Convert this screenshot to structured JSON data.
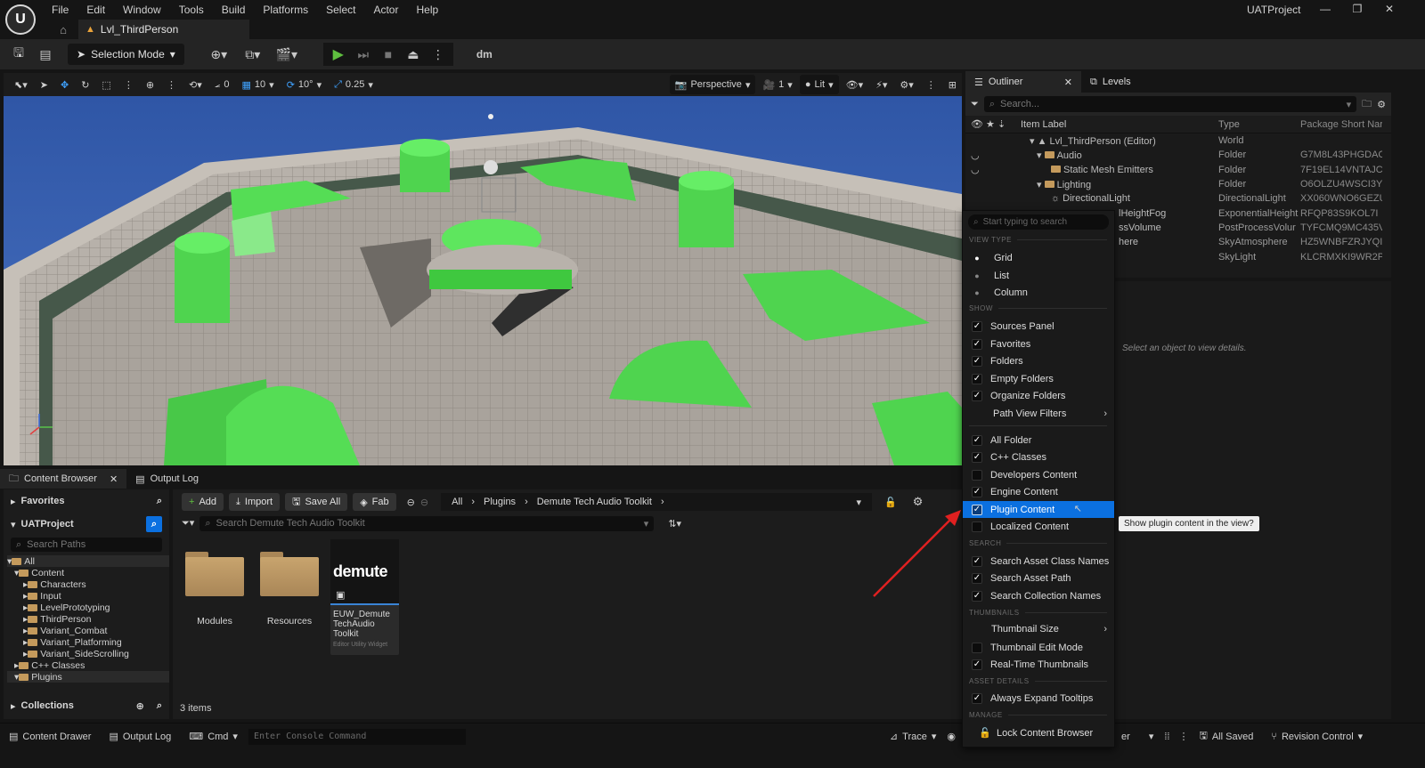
{
  "menu": [
    "File",
    "Edit",
    "Window",
    "Tools",
    "Build",
    "Platforms",
    "Select",
    "Actor",
    "Help"
  ],
  "level_tab": "Lvl_ThirdPerson",
  "project": "UATProject",
  "toolbar": {
    "selection_mode": "Selection Mode",
    "platform": "dm"
  },
  "viewport_toolbar": {
    "grid_snap": "10",
    "rotation_snap": "10°",
    "scale_snap": "0.25",
    "rot_value": "0",
    "perspective": "Perspective",
    "camera_speed": "1",
    "view_mode": "Lit"
  },
  "outliner": {
    "tab_label": "Outliner",
    "levels_tab": "Levels",
    "search_placeholder": "Search...",
    "columns": [
      "Item Label",
      "Type",
      "Package Short Nar"
    ],
    "rows": [
      {
        "label": "Lvl_ThirdPerson (Editor)",
        "type": "World",
        "pkg": ""
      },
      {
        "label": "Audio",
        "type": "Folder",
        "pkg": "G7M8L43PHGDAC"
      },
      {
        "label": "Static Mesh Emitters",
        "type": "Folder",
        "pkg": "7F19EL14VNTAJC"
      },
      {
        "label": "Lighting",
        "type": "Folder",
        "pkg": "O6OLZU4WSCI3Y"
      },
      {
        "label": "DirectionalLight",
        "type": "DirectionalLight",
        "pkg": "XX060WNO6GEZU"
      },
      {
        "label": "lHeightFog",
        "type": "ExponentialHeight",
        "pkg": "RFQP83S9KOL7I"
      },
      {
        "label": "ssVolume",
        "type": "PostProcessVolur",
        "pkg": "TYFCMQ9MC435V"
      },
      {
        "label": "here",
        "type": "SkyAtmosphere",
        "pkg": "HZ5WNBFZRJYQI"
      },
      {
        "label": "",
        "type": "SkyLight",
        "pkg": "KLCRMXKI9WR2P"
      }
    ]
  },
  "details": {
    "empty_message": "Select an object to view details."
  },
  "content_browser": {
    "tab_label": "Content Browser",
    "output_log_tab": "Output Log",
    "favorites": "Favorites",
    "project": "UATProject",
    "search_paths_placeholder": "Search Paths",
    "tree": [
      "All",
      "Content",
      "Characters",
      "Input",
      "LevelPrototyping",
      "ThirdPerson",
      "Variant_Combat",
      "Variant_Platforming",
      "Variant_SideScrolling",
      "C++ Classes",
      "Plugins"
    ],
    "collections": "Collections",
    "buttons": {
      "add": "Add",
      "import": "Import",
      "save_all": "Save All",
      "fab": "Fab"
    },
    "breadcrumb": [
      "All",
      "Plugins",
      "Demute Tech Audio Toolkit"
    ],
    "search_placeholder": "Search Demute Tech Audio Toolkit",
    "items": [
      {
        "name": "Modules"
      },
      {
        "name": "Resources"
      },
      {
        "name": "EUW_Demute TechAudio Toolkit",
        "type": "Editor Utility Widget",
        "thumb": "demute"
      }
    ],
    "count": "3 items"
  },
  "statusbar": {
    "content_drawer": "Content Drawer",
    "output_log": "Output Log",
    "cmd": "Cmd",
    "console_placeholder": "Enter Console Command",
    "trace": "Trace",
    "er": "er",
    "all_saved": "All Saved",
    "revision_control": "Revision Control"
  },
  "dropdown": {
    "search_placeholder": "Start typing to search",
    "sections": {
      "view_type": "VIEW TYPE",
      "show": "SHOW",
      "search": "SEARCH",
      "thumbnails": "THUMBNAILS",
      "asset_details": "ASSET DETAILS",
      "manage": "MANAGE"
    },
    "view_type": [
      "Grid",
      "List",
      "Column"
    ],
    "show": [
      {
        "label": "Sources Panel",
        "checked": true
      },
      {
        "label": "Favorites",
        "checked": true
      },
      {
        "label": "Folders",
        "checked": true
      },
      {
        "label": "Empty Folders",
        "checked": true
      },
      {
        "label": "Organize Folders",
        "checked": true
      },
      {
        "label": "Path View Filters",
        "submenu": true
      },
      {
        "label": "All Folder",
        "checked": true
      },
      {
        "label": "C++ Classes",
        "checked": true
      },
      {
        "label": "Developers Content",
        "checked": false
      },
      {
        "label": "Engine Content",
        "checked": true
      },
      {
        "label": "Plugin Content",
        "checked": true,
        "highlighted": true
      },
      {
        "label": "Localized Content",
        "checked": false
      }
    ],
    "search": [
      {
        "label": "Search Asset Class Names",
        "checked": true
      },
      {
        "label": "Search Asset Path",
        "checked": true
      },
      {
        "label": "Search Collection Names",
        "checked": true
      }
    ],
    "thumbnails": [
      {
        "label": "Thumbnail Size",
        "submenu": true
      },
      {
        "label": "Thumbnail Edit Mode",
        "checked": false
      },
      {
        "label": "Real-Time Thumbnails",
        "checked": true
      }
    ],
    "asset_details": [
      {
        "label": "Always Expand Tooltips",
        "checked": true
      }
    ],
    "manage": [
      {
        "label": "Lock Content Browser"
      }
    ]
  },
  "tooltip": "Show plugin content in the view?",
  "colors": {
    "accent": "#0b70e0",
    "floor_green": "#4fd44f",
    "viewport_sky": "#3a63b5",
    "annotation_arrow": "#e02020"
  }
}
